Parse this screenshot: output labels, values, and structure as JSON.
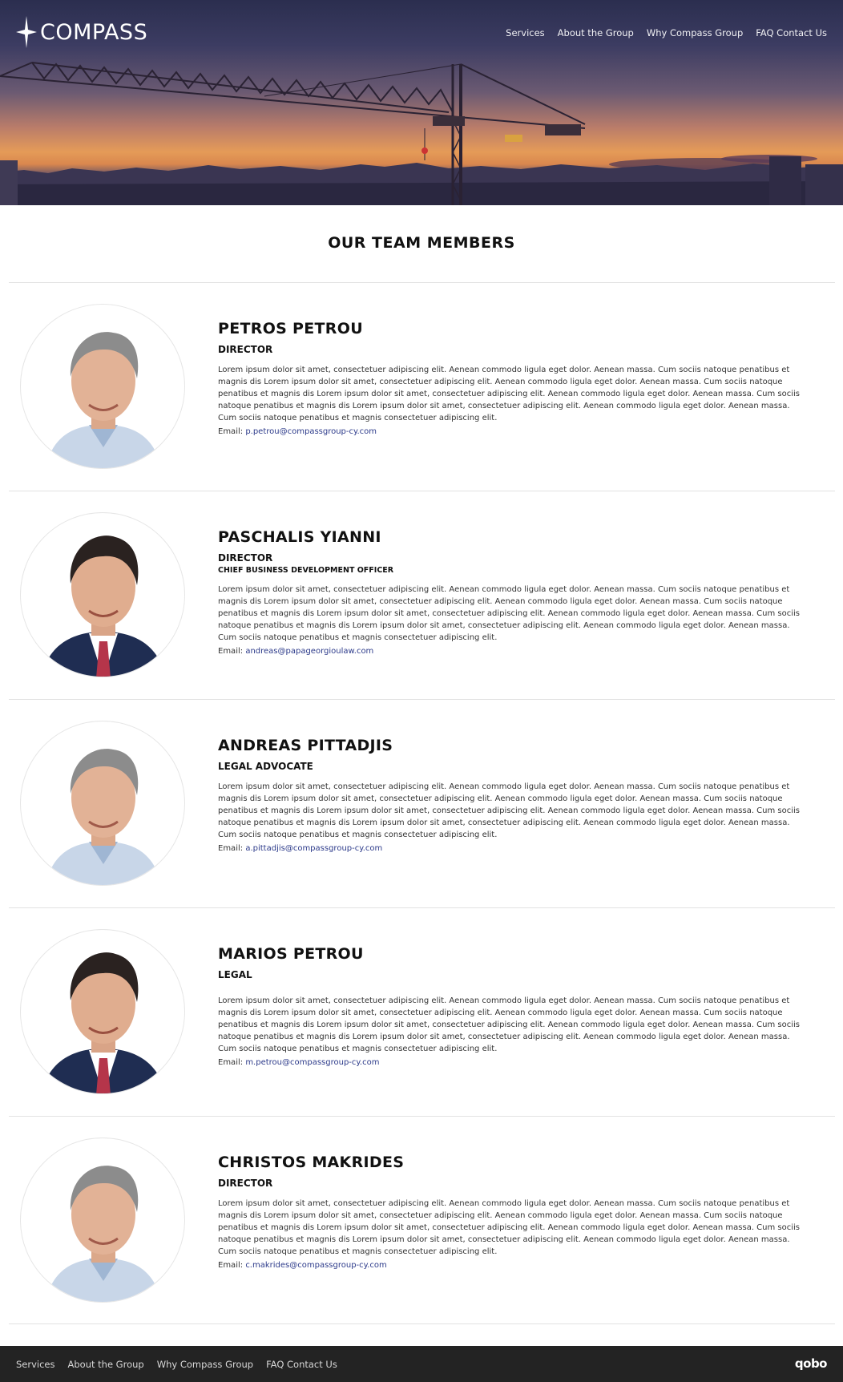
{
  "header": {
    "logo_text": "COMPASS",
    "nav": [
      "Services",
      "About the Group",
      "Why Compass Group",
      "FAQ Contact Us"
    ]
  },
  "team": {
    "title": "OUR TEAM MEMBERS",
    "email_label": "Email:",
    "members": [
      {
        "name": "PETROS PETROU",
        "role": "DIRECTOR",
        "role2": "",
        "bio": "Lorem ipsum dolor sit amet, consectetuer adipiscing elit. Aenean commodo ligula eget dolor. Aenean massa. Cum sociis natoque penatibus et magnis dis Lorem ipsum dolor sit amet, consectetuer adipiscing elit. Aenean commodo ligula eget dolor. Aenean massa. Cum sociis natoque penatibus et magnis dis Lorem ipsum dolor sit amet, consectetuer adipiscing elit. Aenean commodo ligula eget dolor. Aenean massa. Cum sociis natoque penatibus et magnis dis Lorem ipsum dolor sit amet, consectetuer adipiscing elit. Aenean commodo ligula eget dolor. Aenean massa. Cum sociis natoque penatibus et magnis consectetuer adipiscing elit.",
        "email": "p.petrou@compassgroup-cy.com"
      },
      {
        "name": "PASCHALIS YIANNI",
        "role": "DIRECTOR",
        "role2": "CHIEF BUSINESS DEVELOPMENT OFFICER",
        "bio": "Lorem ipsum dolor sit amet, consectetuer adipiscing elit. Aenean commodo ligula eget dolor. Aenean massa. Cum sociis natoque penatibus et magnis dis Lorem ipsum dolor sit amet, consectetuer adipiscing elit. Aenean commodo ligula eget dolor. Aenean massa. Cum sociis natoque penatibus et magnis dis Lorem ipsum dolor sit amet, consectetuer adipiscing elit. Aenean commodo ligula eget dolor. Aenean massa. Cum sociis natoque penatibus et magnis dis Lorem ipsum dolor sit amet, consectetuer adipiscing elit. Aenean commodo ligula eget dolor. Aenean massa. Cum sociis natoque penatibus et magnis consectetuer adipiscing elit.",
        "email": "andreas@papageorgioulaw.com"
      },
      {
        "name": "ANDREAS PITTADJIS",
        "role": "LEGAL ADVOCATE",
        "role2": "",
        "bio": "Lorem ipsum dolor sit amet, consectetuer adipiscing elit. Aenean commodo ligula eget dolor. Aenean massa. Cum sociis natoque penatibus et magnis dis Lorem ipsum dolor sit amet, consectetuer adipiscing elit. Aenean commodo ligula eget dolor. Aenean massa. Cum sociis natoque penatibus et magnis dis Lorem ipsum dolor sit amet, consectetuer adipiscing elit. Aenean commodo ligula eget dolor. Aenean massa. Cum sociis natoque penatibus et magnis dis Lorem ipsum dolor sit amet, consectetuer adipiscing elit. Aenean commodo ligula eget dolor. Aenean massa. Cum sociis natoque penatibus et magnis consectetuer adipiscing elit.",
        "email": "a.pittadjis@compassgroup-cy.com"
      },
      {
        "name": "MARIOS PETROU",
        "role": "LEGAL",
        "role2": "",
        "bio": "Lorem ipsum dolor sit amet, consectetuer adipiscing elit. Aenean commodo ligula eget dolor. Aenean massa. Cum sociis natoque penatibus et magnis dis Lorem ipsum dolor sit amet, consectetuer adipiscing elit. Aenean commodo ligula eget dolor. Aenean massa. Cum sociis natoque penatibus et magnis dis Lorem ipsum dolor sit amet, consectetuer adipiscing elit. Aenean commodo ligula eget dolor. Aenean massa. Cum sociis natoque penatibus et magnis dis Lorem ipsum dolor sit amet, consectetuer adipiscing elit. Aenean commodo ligula eget dolor. Aenean massa. Cum sociis natoque penatibus et magnis consectetuer adipiscing elit.",
        "email": "m.petrou@compassgroup-cy.com"
      },
      {
        "name": "CHRISTOS MAKRIDES",
        "role": "DIRECTOR",
        "role2": "",
        "bio": "Lorem ipsum dolor sit amet, consectetuer adipiscing elit. Aenean commodo ligula eget dolor. Aenean massa. Cum sociis natoque penatibus et magnis dis Lorem ipsum dolor sit amet, consectetuer adipiscing elit. Aenean commodo ligula eget dolor. Aenean massa. Cum sociis natoque penatibus et magnis dis Lorem ipsum dolor sit amet, consectetuer adipiscing elit. Aenean commodo ligula eget dolor. Aenean massa. Cum sociis natoque penatibus et magnis dis Lorem ipsum dolor sit amet, consectetuer adipiscing elit. Aenean commodo ligula eget dolor. Aenean massa. Cum sociis natoque penatibus et magnis consectetuer adipiscing elit.",
        "email": "c.makrides@compassgroup-cy.com"
      }
    ]
  },
  "footer": {
    "nav": [
      "Services",
      "About the Group",
      "Why Compass Group",
      "FAQ Contact Us"
    ],
    "brand": "qobo"
  },
  "colors": {
    "link": "#2c3a8a",
    "footer_bg": "#232323",
    "divider": "#e2e2e2"
  },
  "icons": [
    "compass-logo-icon",
    "person-photo"
  ]
}
